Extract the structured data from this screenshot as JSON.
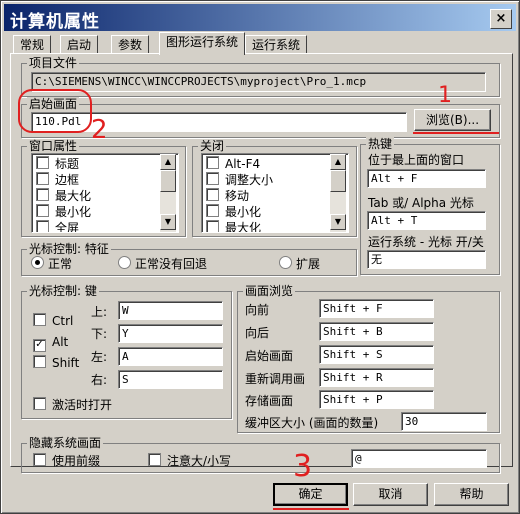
{
  "window": {
    "title": "计算机属性",
    "close_glyph": "×"
  },
  "tabs": [
    "常规",
    "启动",
    "参数",
    "图形运行系统",
    "运行系统"
  ],
  "project_file": {
    "label": "项目文件",
    "value": "C:\\SIEMENS\\WINCC\\WINCCPROJECTS\\myproject\\Pro_1.mcp"
  },
  "start_screen": {
    "label": "启始画面",
    "value": "110.Pdl",
    "browse_label": "浏览(B)..."
  },
  "window_attributes": {
    "label": "窗口属性",
    "items": [
      "标题",
      "边框",
      "最大化",
      "最小化",
      "全屏"
    ]
  },
  "close_group": {
    "label": "关闭",
    "items": [
      "Alt-F4",
      "调整大小",
      "移动",
      "最小化",
      "最大化"
    ]
  },
  "hotkeys": {
    "label": "热键",
    "topmost_label": "位于最上面的窗口",
    "topmost_value": "Alt + F",
    "tab_alpha_label": "Tab 或/ Alpha 光标",
    "tab_alpha_value": "Alt + T",
    "runtime_cursor_label": "运行系统 - 光标 开/关",
    "runtime_cursor_value": "无"
  },
  "cursor_control_feature": {
    "label": "光标控制: 特征",
    "options": [
      "正常",
      "正常没有回退",
      "扩展"
    ],
    "selected": "正常"
  },
  "cursor_control_keys": {
    "label": "光标控制: 键",
    "modifiers": [
      {
        "label": "Ctrl",
        "checked": false
      },
      {
        "label": "Alt",
        "checked": true
      },
      {
        "label": "Shift",
        "checked": false
      }
    ],
    "up_label": "上:",
    "up_value": "W",
    "down_label": "下:",
    "down_value": "Y",
    "left_label": "左:",
    "left_value": "A",
    "right_label": "右:",
    "right_value": "S",
    "activate_label": "激活时打开"
  },
  "screen_browse": {
    "label": "画面浏览",
    "rows": [
      {
        "label": "向前",
        "value": "Shift + F"
      },
      {
        "label": "向后",
        "value": "Shift + B"
      },
      {
        "label": "启始画面",
        "value": "Shift + S"
      },
      {
        "label": "重新调用画",
        "value": "Shift + R"
      },
      {
        "label": "存储画面",
        "value": "Shift + P"
      }
    ],
    "buffer_label": "缓冲区大小 (画面的数量)",
    "buffer_value": "30"
  },
  "hide_system_screens": {
    "label": "隐藏系统画面",
    "use_prefix_label": "使用前缀",
    "case_label": "注意大/小写",
    "prefix_value": "@"
  },
  "buttons": {
    "ok": "确定",
    "cancel": "取消",
    "help": "帮助"
  },
  "annotations": {
    "one": "1",
    "two": "2",
    "three": "3"
  },
  "colors": {
    "annotation_red": "#e02020",
    "title_blue": "#0a246a"
  }
}
